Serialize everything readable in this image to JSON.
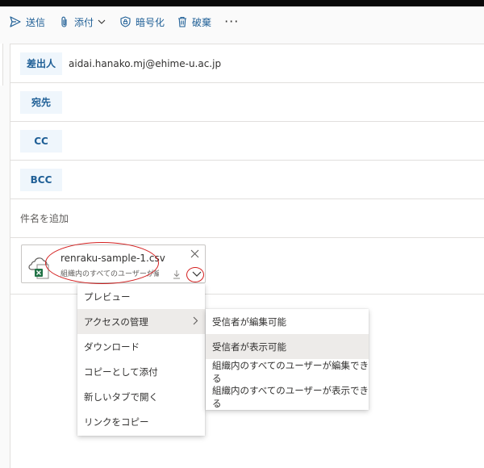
{
  "toolbar": {
    "send": "送信",
    "attach": "添付",
    "encrypt": "暗号化",
    "discard": "破棄",
    "more": "···"
  },
  "fields": {
    "from_label": "差出人",
    "from_value": "aidai.hanako.mj@ehime-u.ac.jp",
    "to_label": "宛先",
    "cc_label": "CC",
    "bcc_label": "BCC",
    "subject_placeholder": "件名を追加"
  },
  "attachment": {
    "filename": "renraku-sample-1.csv",
    "sharing": "組織内のすべてのユーザーが編..."
  },
  "menu": {
    "items": [
      "プレビュー",
      "アクセスの管理",
      "ダウンロード",
      "コピーとして添付",
      "新しいタブで開く",
      "リンクをコピー"
    ]
  },
  "submenu": {
    "items": [
      "受信者が編集可能",
      "受信者が表示可能",
      "組織内のすべてのユーザーが編集できる",
      "組織内のすべてのユーザーが表示できる"
    ]
  },
  "colors": {
    "accent": "#1f5f96",
    "annotation": "#d42020",
    "excel_green": "#217346"
  }
}
